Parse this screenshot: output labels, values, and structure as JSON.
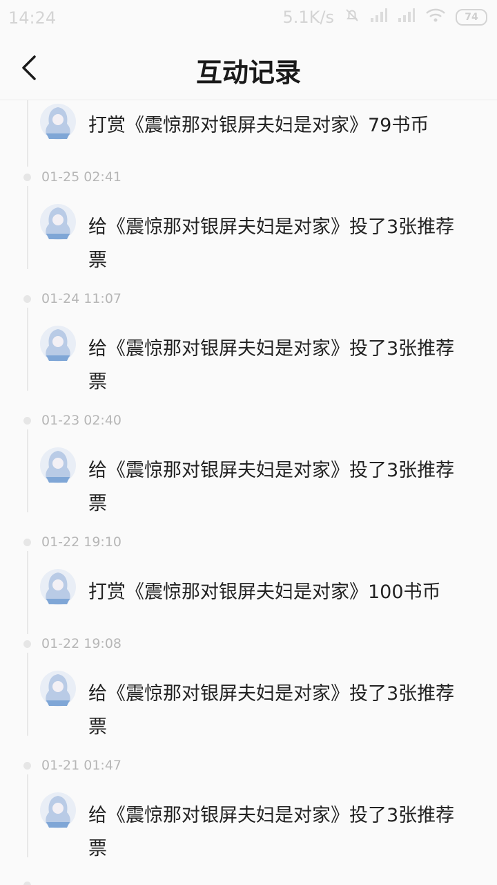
{
  "status_bar": {
    "time": "14:24",
    "speed": "5.1K/s",
    "battery": "74",
    "icons": [
      "bell-muted-icon",
      "signal-icon",
      "signal-icon",
      "wifi-icon",
      "battery-icon"
    ]
  },
  "header": {
    "back_icon": "chevron-left-icon",
    "title": "互动记录"
  },
  "records": [
    {
      "date": "",
      "text": "打赏《震惊那对银屏夫妇是对家》79书币"
    },
    {
      "date": "01-25 02:41",
      "text": "给《震惊那对银屏夫妇是对家》投了3张推荐票"
    },
    {
      "date": "01-24 11:07",
      "text": "给《震惊那对银屏夫妇是对家》投了3张推荐票"
    },
    {
      "date": "01-23 02:40",
      "text": "给《震惊那对银屏夫妇是对家》投了3张推荐票"
    },
    {
      "date": "01-22 19:10",
      "text": "打赏《震惊那对银屏夫妇是对家》100书币"
    },
    {
      "date": "01-22 19:08",
      "text": "给《震惊那对银屏夫妇是对家》投了3张推荐票"
    },
    {
      "date": "01-21 01:47",
      "text": "给《震惊那对银屏夫妇是对家》投了3张推荐票"
    }
  ],
  "colors": {
    "background": "#fafafa",
    "text": "#222222",
    "date": "#b6b6b6",
    "timeline": "#e8e8e8",
    "avatar_accent": "#7fa6d6"
  }
}
